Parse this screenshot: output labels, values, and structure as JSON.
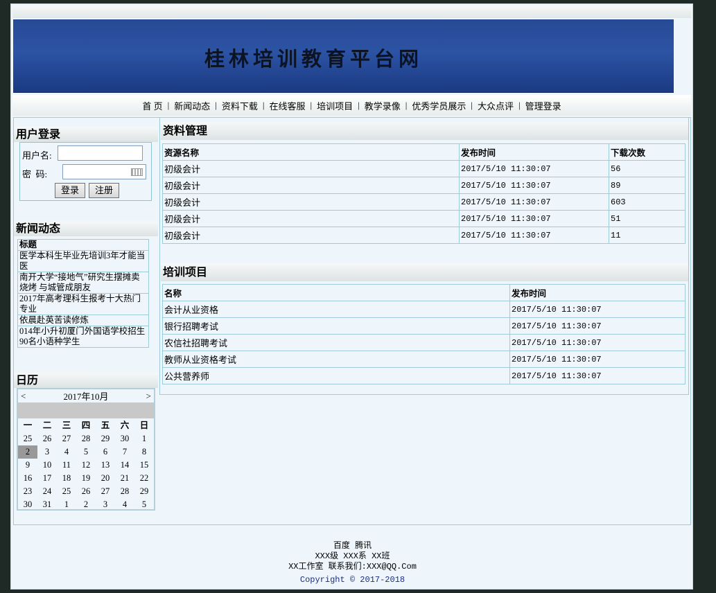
{
  "banner": {
    "title": "桂林培训教育平台网"
  },
  "nav": [
    "首 页",
    "新闻动态",
    "资料下载",
    "在线客服",
    "培训项目",
    "教学录像",
    "优秀学员展示",
    "大众点评",
    "管理登录"
  ],
  "login": {
    "title": "用户登录",
    "username_label": "用户名:",
    "password_label": "密  码:",
    "login_button": "登录",
    "register_button": "注册"
  },
  "news": {
    "title": "新闻动态",
    "header": "标题",
    "items": [
      "医学本科生毕业先培训3年才能当医",
      "南开大学“接地气”研究生摆摊卖烧烤 与城管成朋友",
      "2017年高考理科生报考十大热门专业",
      "依晨赴英苦读修炼",
      "014年小升初厦门外国语学校招生90名小语种学生"
    ]
  },
  "calendar": {
    "title": "日历",
    "prev": "<",
    "next": ">",
    "month_label": "2017年10月",
    "weekdays": [
      "一",
      "二",
      "三",
      "四",
      "五",
      "六",
      "日"
    ],
    "days": [
      "25",
      "26",
      "27",
      "28",
      "29",
      "30",
      "1",
      "2",
      "3",
      "4",
      "5",
      "6",
      "7",
      "8",
      "9",
      "10",
      "11",
      "12",
      "13",
      "14",
      "15",
      "16",
      "17",
      "18",
      "19",
      "20",
      "21",
      "22",
      "23",
      "24",
      "25",
      "26",
      "27",
      "28",
      "29",
      "30",
      "31",
      "1",
      "2",
      "3",
      "4",
      "5"
    ],
    "selected": "2"
  },
  "materials": {
    "title": "资料管理",
    "headers": [
      "资源名称",
      "发布时间",
      "下载次数"
    ],
    "rows": [
      [
        "初级会计",
        "2017/5/10 11:30:07",
        "56"
      ],
      [
        "初级会计",
        "2017/5/10 11:30:07",
        "89"
      ],
      [
        "初级会计",
        "2017/5/10 11:30:07",
        "603"
      ],
      [
        "初级会计",
        "2017/5/10 11:30:07",
        "51"
      ],
      [
        "初级会计",
        "2017/5/10 11:30:07",
        "11"
      ]
    ]
  },
  "training": {
    "title": "培训项目",
    "headers": [
      "名称",
      "发布时间"
    ],
    "rows": [
      [
        "会计从业资格",
        "2017/5/10 11:30:07"
      ],
      [
        "银行招聘考试",
        "2017/5/10 11:30:07"
      ],
      [
        "农信社招聘考试",
        "2017/5/10 11:30:07"
      ],
      [
        "教师从业资格考试",
        "2017/5/10 11:30:07"
      ],
      [
        "公共营养师",
        "2017/5/10 11:30:07"
      ]
    ]
  },
  "footer": {
    "link_baidu": "百度",
    "link_tencent": "腾讯",
    "line2": "XXX级 XXX系 XX班",
    "line3": "XX工作室 联系我们:XXX@QQ.Com",
    "copyright": "Copyright © 2017-2018"
  }
}
